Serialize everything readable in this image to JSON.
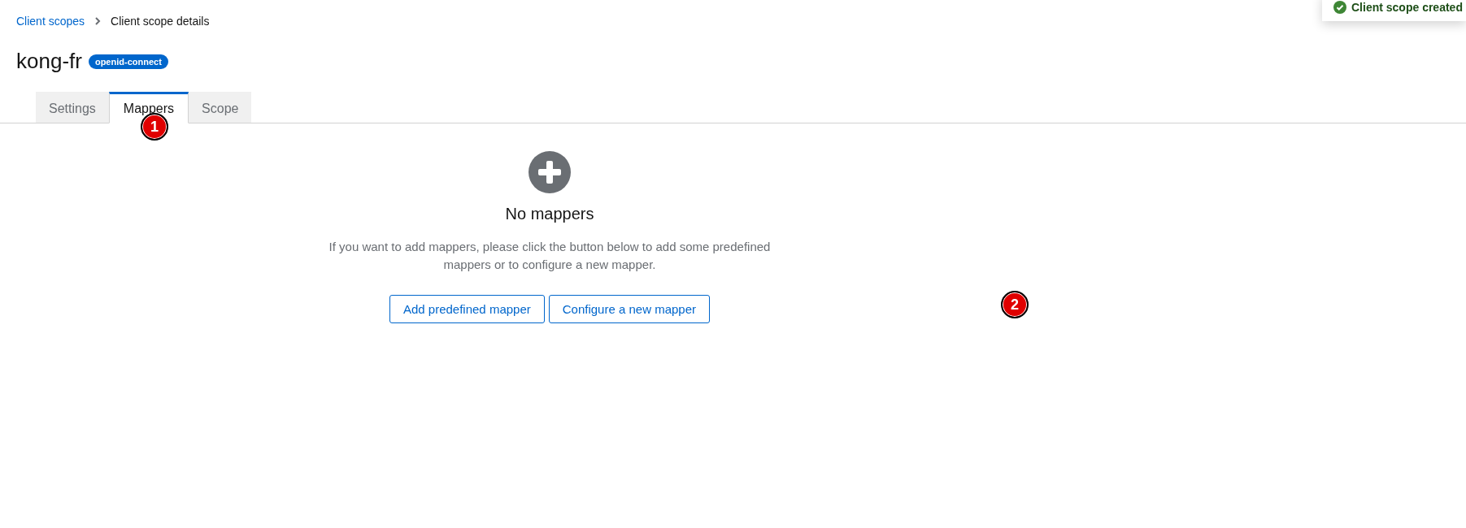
{
  "breadcrumb": [
    {
      "label": "Client scopes",
      "kind": "link"
    },
    {
      "label": "Client scope details",
      "kind": "current"
    }
  ],
  "title": "kong-fr",
  "badge": "openid-connect",
  "tabs": [
    {
      "label": "Settings",
      "selected": false
    },
    {
      "label": "Mappers",
      "selected": true
    },
    {
      "label": "Scope",
      "selected": false
    }
  ],
  "empty_state": {
    "title": "No mappers",
    "text": "If you want to add mappers, please click the button below to add some predefined mappers or to configure a new mapper.",
    "buttons": [
      "Add predefined mapper",
      "Configure a new mapper"
    ]
  },
  "annotations": [
    "1",
    "2"
  ],
  "toast": {
    "message": "Client scope created"
  }
}
